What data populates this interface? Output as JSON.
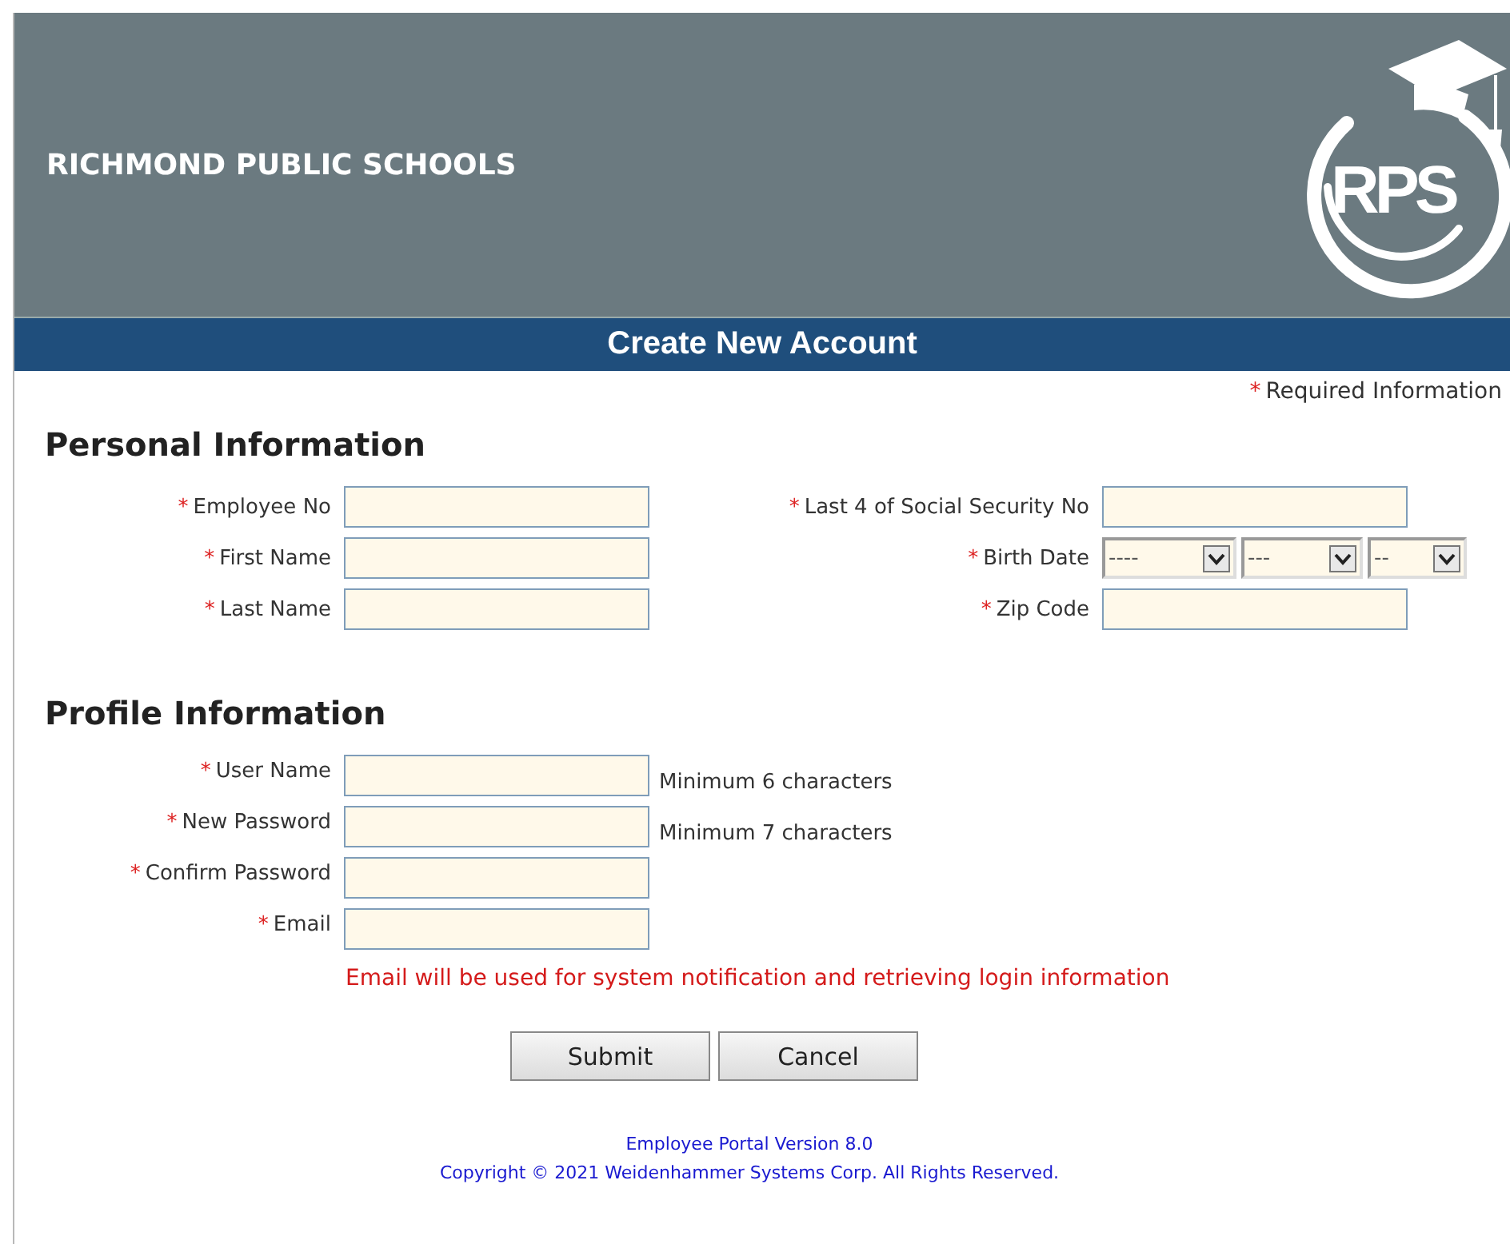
{
  "header": {
    "title": "RICHMOND PUBLIC SCHOOLS",
    "logo_text": "RPS"
  },
  "banner": "Create New Account",
  "required_note": {
    "mark": "*",
    "text": "Required Information"
  },
  "personal": {
    "heading": "Personal Information",
    "left": [
      {
        "mark": "*",
        "label": "Employee No"
      },
      {
        "mark": "*",
        "label": "First Name"
      },
      {
        "mark": "*",
        "label": "Last Name"
      }
    ],
    "right": [
      {
        "kind": "input",
        "mark": "*",
        "label": "Last 4 of Social Security No"
      },
      {
        "kind": "date",
        "mark": "*",
        "label": "Birth Date",
        "selects": [
          "----",
          "---",
          "--"
        ]
      },
      {
        "kind": "input",
        "mark": "*",
        "label": "Zip Code"
      }
    ]
  },
  "profile": {
    "heading": "Profile Information",
    "fields": [
      {
        "mark": "*",
        "label": "User Name",
        "hint": "Minimum 6 characters"
      },
      {
        "mark": "*",
        "label": "New Password",
        "hint": "Minimum 7 characters"
      },
      {
        "mark": "*",
        "label": "Confirm Password"
      },
      {
        "mark": "*",
        "label": "Email"
      }
    ],
    "note": "Email will be used for system notification and retrieving login information"
  },
  "buttons": [
    "Submit",
    "Cancel"
  ],
  "footer": [
    "Employee Portal Version 8.0",
    "Copyright © 2021 Weidenhammer Systems Corp. All Rights Reserved."
  ]
}
